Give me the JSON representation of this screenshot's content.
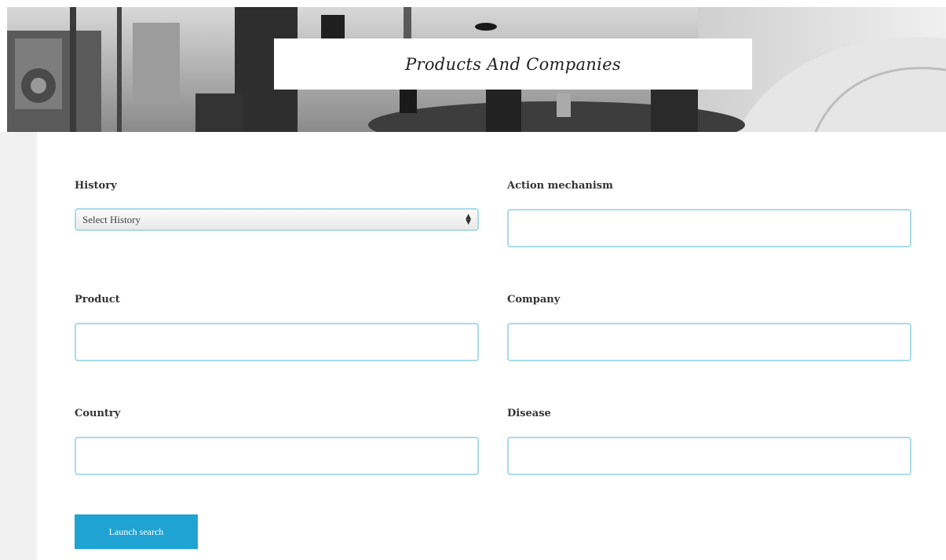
{
  "header": {
    "title": "Products And Companies"
  },
  "form": {
    "history": {
      "label": "History",
      "selected": "Select History"
    },
    "action_mechanism": {
      "label": "Action mechanism",
      "value": ""
    },
    "product": {
      "label": "Product",
      "value": ""
    },
    "company": {
      "label": "Company",
      "value": ""
    },
    "country": {
      "label": "Country",
      "value": ""
    },
    "disease": {
      "label": "Disease",
      "value": ""
    },
    "submit_label": "Launch search"
  },
  "colors": {
    "input_border": "#a9dbeb",
    "button_bg": "#1fa3d3",
    "gutter": "#f1f1f1"
  },
  "icons": {
    "select_arrows": "sort-arrows-icon"
  }
}
